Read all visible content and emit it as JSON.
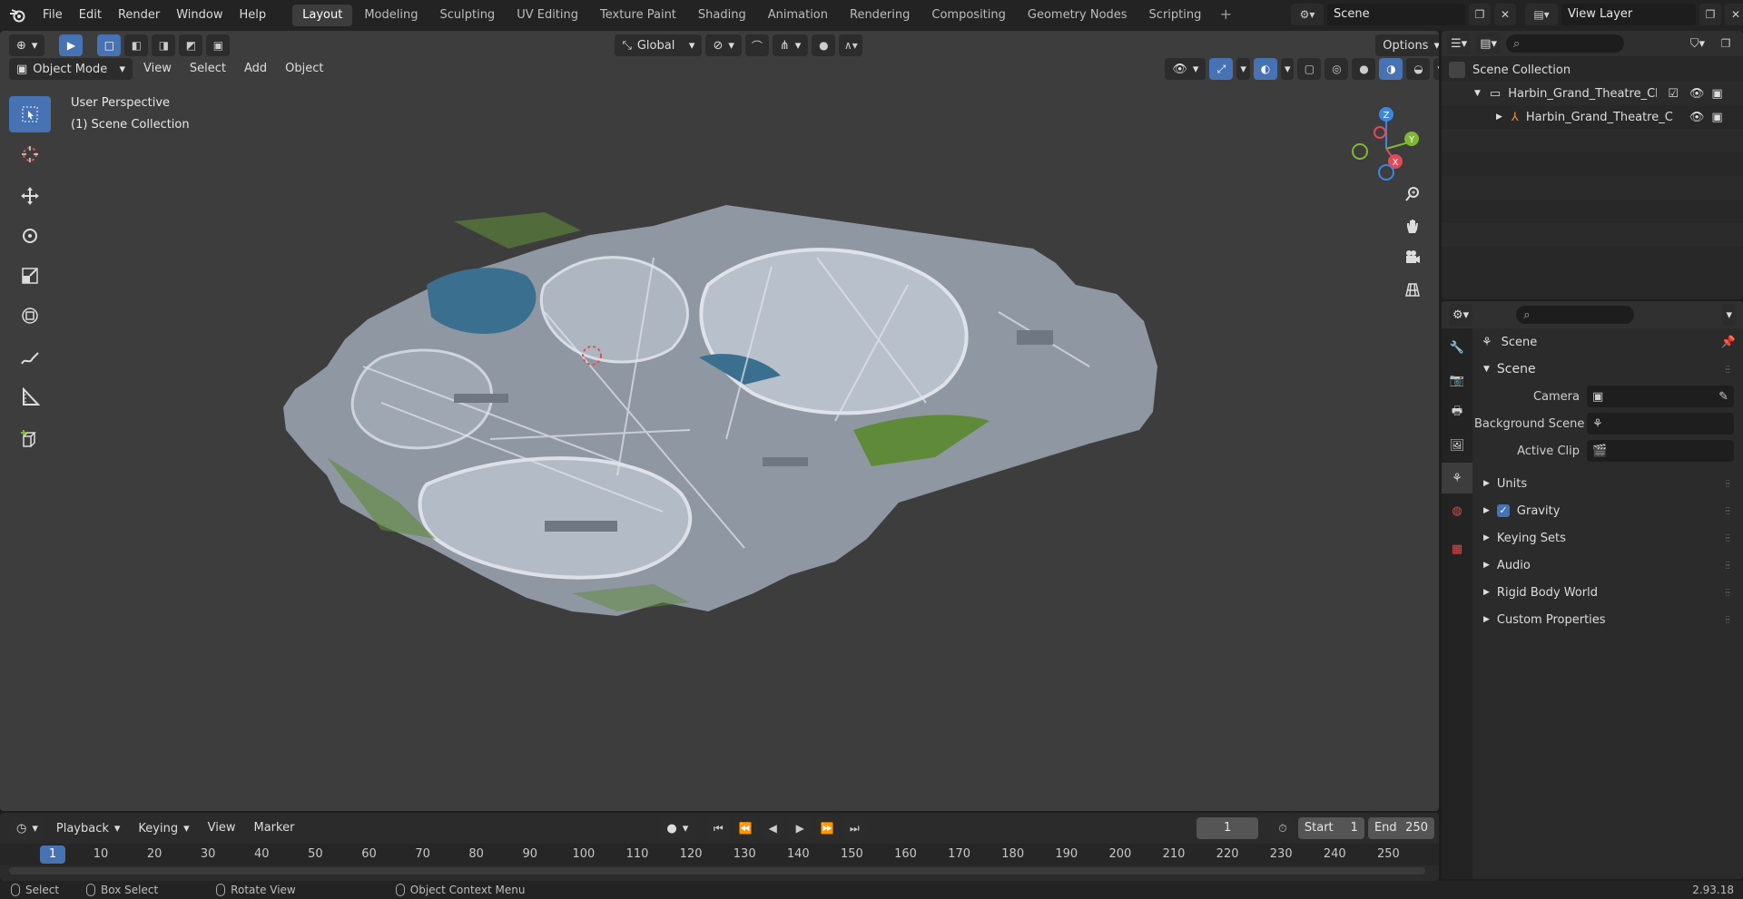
{
  "menu": [
    "File",
    "Edit",
    "Render",
    "Window",
    "Help"
  ],
  "workspaces": [
    {
      "label": "Layout",
      "active": true
    },
    {
      "label": "Modeling"
    },
    {
      "label": "Sculpting"
    },
    {
      "label": "UV Editing"
    },
    {
      "label": "Texture Paint"
    },
    {
      "label": "Shading"
    },
    {
      "label": "Animation"
    },
    {
      "label": "Rendering"
    },
    {
      "label": "Compositing"
    },
    {
      "label": "Geometry Nodes"
    },
    {
      "label": "Scripting"
    }
  ],
  "scene_selector": {
    "value": "Scene"
  },
  "view_layer_selector": {
    "value": "View Layer"
  },
  "viewport": {
    "mode_label": "Object Mode",
    "menus": [
      "View",
      "Select",
      "Add",
      "Object"
    ],
    "transform_orientation": "Global",
    "options_label": "Options",
    "overlay_line1": "User Perspective",
    "overlay_line2": "(1) Scene Collection",
    "gizmo_axes": {
      "x": "X",
      "y": "Y",
      "z": "Z"
    }
  },
  "timeline": {
    "menus": [
      "Playback",
      "Keying",
      "View",
      "Marker"
    ],
    "current_frame": "1",
    "start_label": "Start",
    "start_value": "1",
    "end_label": "End",
    "end_value": "250",
    "ruler_ticks": [
      "10",
      "20",
      "30",
      "40",
      "50",
      "60",
      "70",
      "80",
      "90",
      "100",
      "110",
      "120",
      "130",
      "140",
      "150",
      "160",
      "170",
      "180",
      "190",
      "200",
      "210",
      "220",
      "230",
      "240",
      "250"
    ],
    "ruler_current": "1"
  },
  "statusbar": {
    "items": [
      "Select",
      "Box Select",
      "Rotate View",
      "Object Context Menu"
    ],
    "version": "2.93.18"
  },
  "outliner": {
    "root": "Scene Collection",
    "collection": "Harbin_Grand_Theatre_China",
    "object": "Harbin_Grand_Theatre_C"
  },
  "properties": {
    "context_title": "Scene",
    "section_scene": "Scene",
    "camera_label": "Camera",
    "background_scene_label": "Background Scene",
    "active_clip_label": "Active Clip",
    "panels": [
      "Units",
      "Gravity",
      "Keying Sets",
      "Audio",
      "Rigid Body World",
      "Custom Properties"
    ]
  },
  "colors": {
    "accent": "#4772b3",
    "viewport_bg": "#3d3d3d",
    "x_axis": "#e04a5a",
    "y_axis": "#7fb832",
    "z_axis": "#3f86e0"
  }
}
